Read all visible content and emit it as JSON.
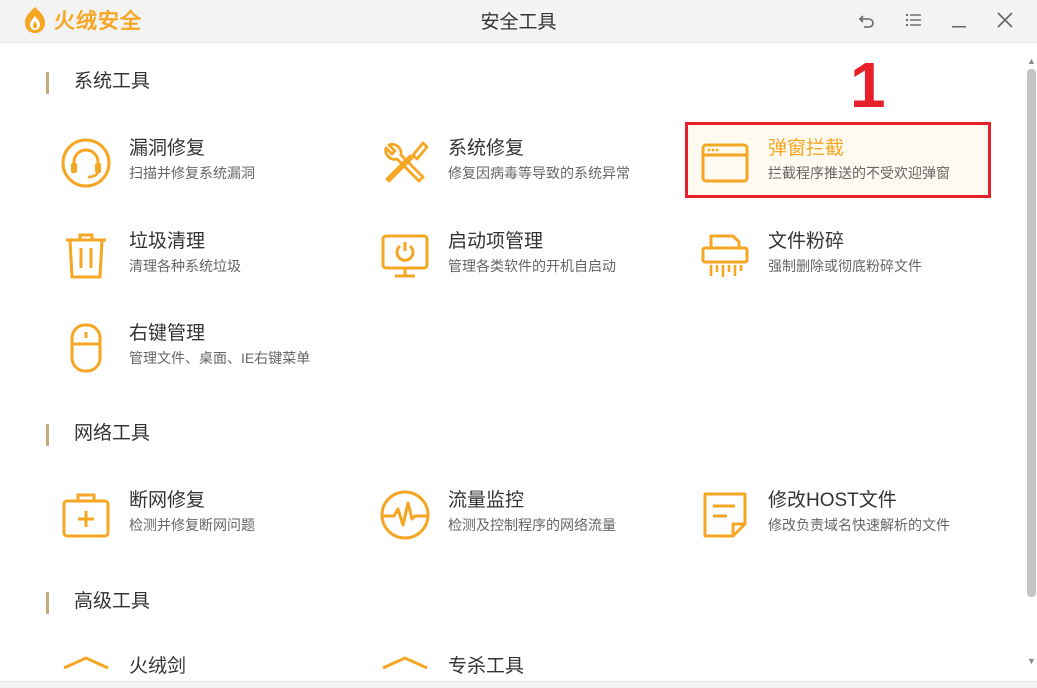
{
  "app": {
    "brand": "火绒安全",
    "window_title": "安全工具"
  },
  "colors": {
    "accent": "#f5a623",
    "highlight": "#e8202a"
  },
  "controls": [
    {
      "name": "back-icon"
    },
    {
      "name": "menu-icon"
    },
    {
      "name": "minimize-icon"
    },
    {
      "name": "close-icon"
    }
  ],
  "sections": {
    "system": {
      "title": "系统工具"
    },
    "network": {
      "title": "网络工具"
    },
    "advanced": {
      "title": "高级工具"
    }
  },
  "tools": {
    "vuln_fix": {
      "name": "漏洞修复",
      "desc": "扫描并修复系统漏洞",
      "icon": "headset-icon"
    },
    "sys_fix": {
      "name": "系统修复",
      "desc": "修复因病毒等导致的系统异常",
      "icon": "wrench-screwdriver-icon"
    },
    "popup_block": {
      "name": "弹窗拦截",
      "desc": "拦截程序推送的不受欢迎弹窗",
      "icon": "window-icon"
    },
    "junk_clean": {
      "name": "垃圾清理",
      "desc": "清理各种系统垃圾",
      "icon": "trash-icon"
    },
    "startup_mgr": {
      "name": "启动项管理",
      "desc": "管理各类软件的开机自启动",
      "icon": "monitor-power-icon"
    },
    "file_shred": {
      "name": "文件粉碎",
      "desc": "强制删除或彻底粉碎文件",
      "icon": "shredder-icon"
    },
    "context_menu": {
      "name": "右键管理",
      "desc": "管理文件、桌面、IE右键菜单",
      "icon": "mouse-icon"
    },
    "net_fix": {
      "name": "断网修复",
      "desc": "检测并修复断网问题",
      "icon": "first-aid-icon"
    },
    "traffic_mon": {
      "name": "流量监控",
      "desc": "检测及控制程序的网络流量",
      "icon": "pulse-icon"
    },
    "host_edit": {
      "name": "修改HOST文件",
      "desc": "修改负责域名快速解析的文件",
      "icon": "document-icon"
    },
    "huorong_sword": {
      "name": "火绒剑",
      "icon": "sword-shield-icon"
    },
    "special_tool": {
      "name": "专杀工具",
      "icon": "shield-icon"
    }
  },
  "annotation": {
    "number": "1"
  }
}
